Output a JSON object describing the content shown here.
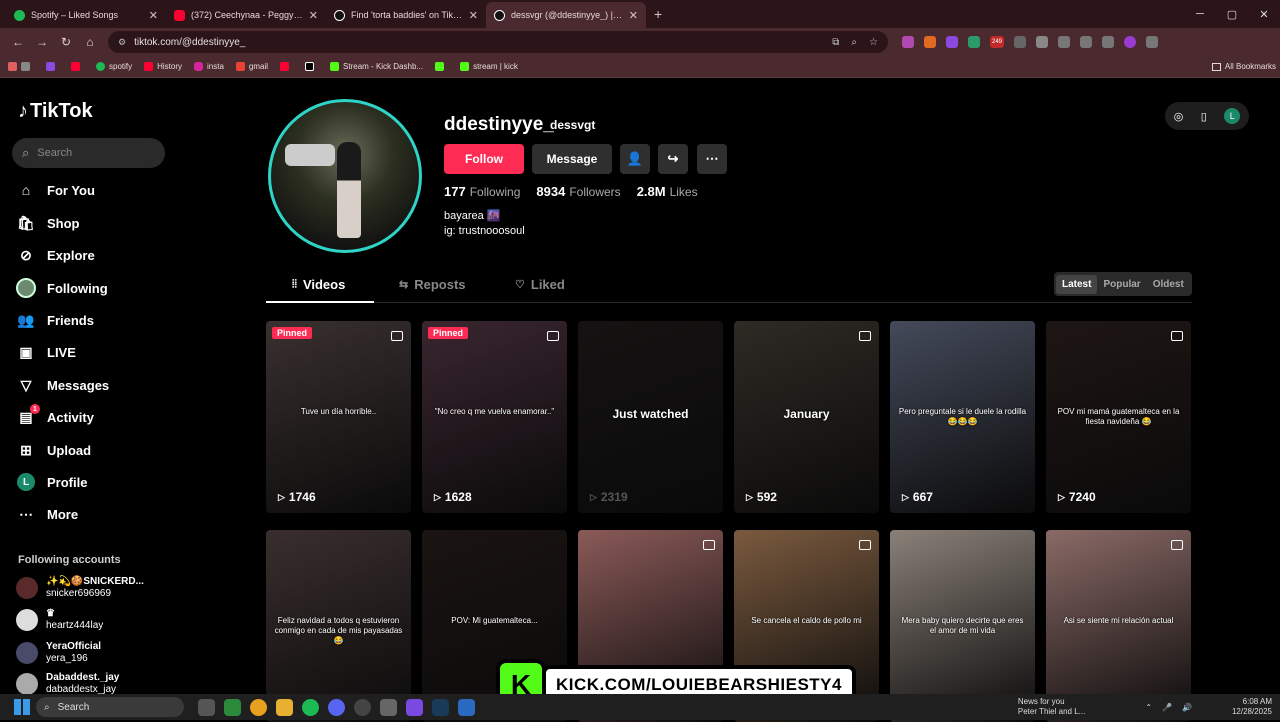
{
  "browser": {
    "tabs": [
      {
        "title": "Spotify – Liked Songs",
        "color": "#1db954"
      },
      {
        "title": "(372) Ceechynaa - Peggy - YouTube",
        "color": "#ff0033"
      },
      {
        "title": "Find 'torta baddies' on TikTok |",
        "color": "#ffffff"
      },
      {
        "title": "dessvgr (@ddestinyye_) | TikTok",
        "color": "#ffffff"
      }
    ],
    "url": "tiktok.com/@ddestinyye_",
    "bookmarks": [
      "spotify",
      "History",
      "insta",
      "gmail",
      "Stream - Kick Dashb...",
      "stream | kick"
    ],
    "all_bookmarks": "All Bookmarks",
    "extension_badge": "249"
  },
  "sidebar": {
    "logo": "TikTok",
    "search_placeholder": "Search",
    "nav": [
      {
        "label": "For You",
        "icon": "home-icon"
      },
      {
        "label": "Shop",
        "icon": "shop-icon"
      },
      {
        "label": "Explore",
        "icon": "compass-icon"
      },
      {
        "label": "Following",
        "icon": "following-avatar"
      },
      {
        "label": "Friends",
        "icon": "friends-icon"
      },
      {
        "label": "LIVE",
        "icon": "live-icon"
      },
      {
        "label": "Messages",
        "icon": "messages-icon"
      },
      {
        "label": "Activity",
        "icon": "activity-icon",
        "badge": "1"
      },
      {
        "label": "Upload",
        "icon": "upload-icon"
      },
      {
        "label": "Profile",
        "icon": "profile-avatar",
        "initial": "L"
      },
      {
        "label": "More",
        "icon": "more-icon"
      }
    ],
    "following_title": "Following accounts",
    "following": [
      {
        "name": "✨💫🍪SNICKERD...",
        "handle": "snicker696969"
      },
      {
        "name": "♛",
        "handle": "heartz444lay"
      },
      {
        "name": "YeraOfficial",
        "handle": "yera_196"
      },
      {
        "name": "Dabaddest._jay",
        "handle": "dabaddestx_jay"
      }
    ]
  },
  "profile": {
    "username": "ddestinyye_",
    "nickname": "dessvgt",
    "follow_label": "Follow",
    "message_label": "Message",
    "following_count": "177",
    "following_label": "Following",
    "followers_count": "8934",
    "followers_label": "Followers",
    "likes_count": "2.8M",
    "likes_label": "Likes",
    "bio_line1": "bayarea 🌆",
    "bio_line2": "ig: trustnooosoul",
    "top_initial": "L"
  },
  "tabs": {
    "videos": "Videos",
    "reposts": "Reposts",
    "liked": "Liked"
  },
  "sort": {
    "latest": "Latest",
    "popular": "Popular",
    "oldest": "Oldest"
  },
  "videos": [
    {
      "pinned": "Pinned",
      "caption": "Tuve un día horrible..",
      "views": "1746",
      "bg": "#3a3030"
    },
    {
      "pinned": "Pinned",
      "caption": "\"No creo q me vuelva enamorar..\"",
      "views": "1628",
      "bg": "#3a2630"
    },
    {
      "pinned": "",
      "caption": "Just watched",
      "views": "2319",
      "bg": "#151212",
      "dim": true
    },
    {
      "pinned": "",
      "caption": "January",
      "views": "592",
      "bg": "#2e2a24"
    },
    {
      "pinned": "",
      "caption": "Pero preguntale si le duele la rodilla 😂😂😂",
      "views": "667",
      "bg": "#444a5a"
    },
    {
      "pinned": "",
      "caption": "POV mi mamá guatemalteca en la fiesta navideña 😂",
      "views": "7240",
      "bg": "#1e1614"
    },
    {
      "pinned": "",
      "caption": "Feliz navidad a todos q estuvieron conmigo en cada de mis payasadas 😂",
      "views": "",
      "bg": "#3a2e2e"
    },
    {
      "pinned": "",
      "caption": "POV: Mi guatemalteca...",
      "views": "",
      "bg": "#1a1412"
    },
    {
      "pinned": "",
      "caption": "",
      "views": "",
      "bg": "#8a5a58"
    },
    {
      "pinned": "",
      "caption": "Se cancela el caldo de pollo mi",
      "views": "",
      "bg": "#7a5a3e"
    },
    {
      "pinned": "",
      "caption": "Mera baby quiero decirte que eres el amor de mi vida",
      "views": "",
      "bg": "#8a8078"
    },
    {
      "pinned": "",
      "caption": "Asi se siente mi relación actual",
      "views": "",
      "bg": "#8a6a66"
    }
  ],
  "overlay": {
    "kick_text": "KICK.COM/LOUIEBEARSHIESTY4"
  },
  "taskbar": {
    "search": "Search",
    "news_title": "News for you",
    "news_sub": "Peter Thiel and L...",
    "time": "6:08 AM",
    "date": "12/28/2025"
  }
}
